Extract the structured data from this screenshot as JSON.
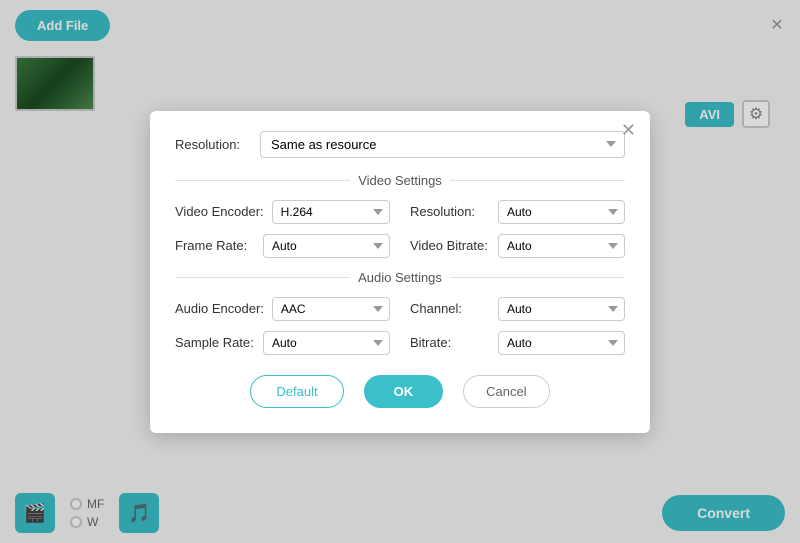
{
  "app": {
    "add_file_label": "Add File",
    "convert_label": "Convert",
    "format_badge": "AVI"
  },
  "dialog": {
    "resolution_label": "Resolution:",
    "resolution_value": "Same as resource",
    "video_settings_title": "Video Settings",
    "audio_settings_title": "Audio Settings",
    "video_encoder_label": "Video Encoder:",
    "video_encoder_value": "H.264",
    "resolution_inner_label": "Resolution:",
    "resolution_inner_value": "Auto",
    "frame_rate_label": "Frame Rate:",
    "frame_rate_value": "Auto",
    "video_bitrate_label": "Video Bitrate:",
    "video_bitrate_value": "Auto",
    "audio_encoder_label": "Audio Encoder:",
    "audio_encoder_value": "AAC",
    "channel_label": "Channel:",
    "channel_value": "Auto",
    "sample_rate_label": "Sample Rate:",
    "sample_rate_value": "Auto",
    "bitrate_label": "Bitrate:",
    "bitrate_value": "Auto",
    "btn_default": "Default",
    "btn_ok": "OK",
    "btn_cancel": "Cancel"
  },
  "icons": {
    "close": "✕",
    "gear": "⚙",
    "film": "🎬",
    "music": "🎵"
  },
  "bottom": {
    "radio1": "MF",
    "radio2": "W"
  }
}
